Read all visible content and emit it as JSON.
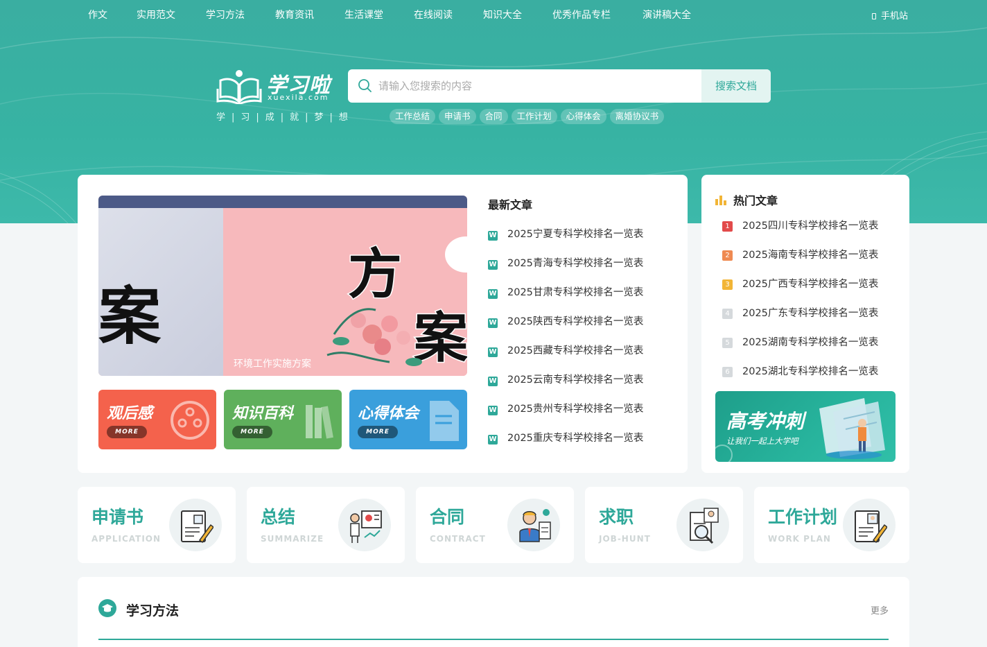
{
  "nav": {
    "items": [
      "作文",
      "实用范文",
      "学习方法",
      "教育资讯",
      "生活课堂",
      "在线阅读",
      "知识大全",
      "优秀作品专栏",
      "演讲稿大全"
    ],
    "mobile_label": "手机站"
  },
  "logo": {
    "name": "学习啦",
    "domain": "xuexila.com",
    "slogan": "学|习|成|就|梦|想"
  },
  "search": {
    "placeholder": "请输入您搜索的内容",
    "button_label": "搜索文档",
    "hotwords": [
      "工作总结",
      "申请书",
      "合同",
      "工作计划",
      "心得体会",
      "离婚协议书"
    ]
  },
  "banner": {
    "caption": "环境工作实施方案"
  },
  "tiles": [
    {
      "title": "观后感",
      "more": "MORE",
      "color": "#f4624c"
    },
    {
      "title": "知识百科",
      "more": "MORE",
      "color": "#5fb05c"
    },
    {
      "title": "心得体会",
      "more": "MORE",
      "color": "#3a9fdc"
    }
  ],
  "latest": {
    "title": "最新文章",
    "items": [
      "2025宁夏专科学校排名一览表",
      "2025青海专科学校排名一览表",
      "2025甘肃专科学校排名一览表",
      "2025陕西专科学校排名一览表",
      "2025西藏专科学校排名一览表",
      "2025云南专科学校排名一览表",
      "2025贵州专科学校排名一览表",
      "2025重庆专科学校排名一览表"
    ]
  },
  "hot": {
    "title": "热门文章",
    "items": [
      {
        "rank": "1",
        "title": "2025四川专科学校排名一览表",
        "color": "#e24a4a"
      },
      {
        "rank": "2",
        "title": "2025海南专科学校排名一览表",
        "color": "#ef8a52"
      },
      {
        "rank": "3",
        "title": "2025广西专科学校排名一览表",
        "color": "#f2b536"
      },
      {
        "rank": "4",
        "title": "2025广东专科学校排名一览表",
        "color": "#d5d9dc"
      },
      {
        "rank": "5",
        "title": "2025湖南专科学校排名一览表",
        "color": "#d5d9dc"
      },
      {
        "rank": "6",
        "title": "2025湖北专科学校排名一览表",
        "color": "#d5d9dc"
      }
    ],
    "promo": {
      "title": "高考冲刺",
      "subtitle": "让我们一起上大学吧"
    }
  },
  "categories": [
    {
      "name": "申请书",
      "en": "APPLICATION",
      "icon": "application-document-icon"
    },
    {
      "name": "总结",
      "en": "SUMMARIZE",
      "icon": "presentation-chart-icon"
    },
    {
      "name": "合同",
      "en": "CONTRACT",
      "icon": "businessman-contract-icon"
    },
    {
      "name": "求职",
      "en": "JOB-HUNT",
      "icon": "resume-magnifier-icon"
    },
    {
      "name": "工作计划",
      "en": "WORK PLAN",
      "icon": "plan-document-icon"
    }
  ],
  "section": {
    "title": "学习方法",
    "more": "更多"
  },
  "colors": {
    "brand": "#2ea899",
    "hero_bg": "#37b3a3"
  }
}
